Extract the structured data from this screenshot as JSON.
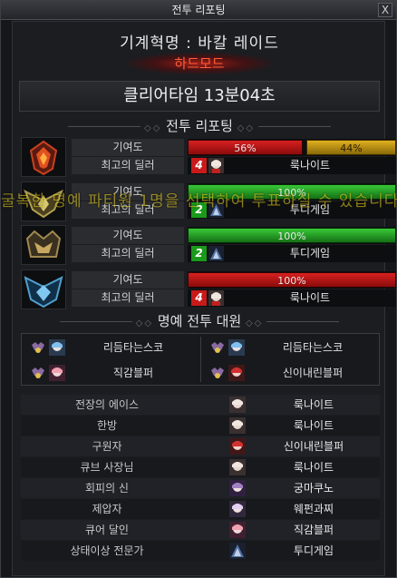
{
  "window": {
    "title": "전투 리포팅",
    "close_label": "X"
  },
  "dungeon": {
    "name": "기계혁명 : 바칼 레이드",
    "mode": "하드모드"
  },
  "clear_time": "클리어타임  13분04초",
  "sections": {
    "report_title": "전투 리포팅",
    "honor_title": "명예 전투 대원"
  },
  "overlay_message": "굴복한 명예 파티원 1명을 선택하여 투표하실 수 있습니다.",
  "labels": {
    "contribution": "기여도",
    "best_dealer": "최고의 딜러"
  },
  "parties": [
    {
      "emblem": "red-flame-emblem",
      "bars": [
        {
          "value": 56,
          "label": "56%",
          "color": "red"
        },
        {
          "value": 44,
          "label": "44%",
          "color": "gold"
        }
      ],
      "dealer_rank": "4",
      "dealer_badge": "red",
      "dealer_name": "룩나이트"
    },
    {
      "emblem": "gold-wing-emblem",
      "bars": [
        {
          "value": 100,
          "label": "100%",
          "color": "green"
        }
      ],
      "dealer_rank": "2",
      "dealer_badge": "green",
      "dealer_name": "투디게임"
    },
    {
      "emblem": "bronze-crown-emblem",
      "bars": [
        {
          "value": 100,
          "label": "100%",
          "color": "green"
        }
      ],
      "dealer_rank": "2",
      "dealer_badge": "green",
      "dealer_name": "투디게임"
    },
    {
      "emblem": "blue-ice-emblem",
      "bars": [
        {
          "value": 100,
          "label": "100%",
          "color": "red"
        }
      ],
      "dealer_rank": "4",
      "dealer_badge": "red",
      "dealer_name": "룩나이트"
    }
  ],
  "honor_members": [
    "리듬타는스코",
    "리듬타는스코",
    "직감블퍼",
    "신이내린블퍼"
  ],
  "awards": [
    {
      "title": "전장의 에이스",
      "player": "룩나이트"
    },
    {
      "title": "한방",
      "player": "룩나이트"
    },
    {
      "title": "구원자",
      "player": "신이내린블퍼"
    },
    {
      "title": "큐브 사장님",
      "player": "룩나이트"
    },
    {
      "title": "회피의 신",
      "player": "궁마쿠노"
    },
    {
      "title": "제압자",
      "player": "웨펀과찌"
    },
    {
      "title": "큐어 달인",
      "player": "직감블퍼"
    },
    {
      "title": "상태이상 전문가",
      "player": "투디게임"
    }
  ],
  "colors": {
    "red_bar": "#d82020",
    "gold_bar": "#e0b020",
    "green_bar": "#38c838",
    "mode_text": "#ff5c3a"
  }
}
